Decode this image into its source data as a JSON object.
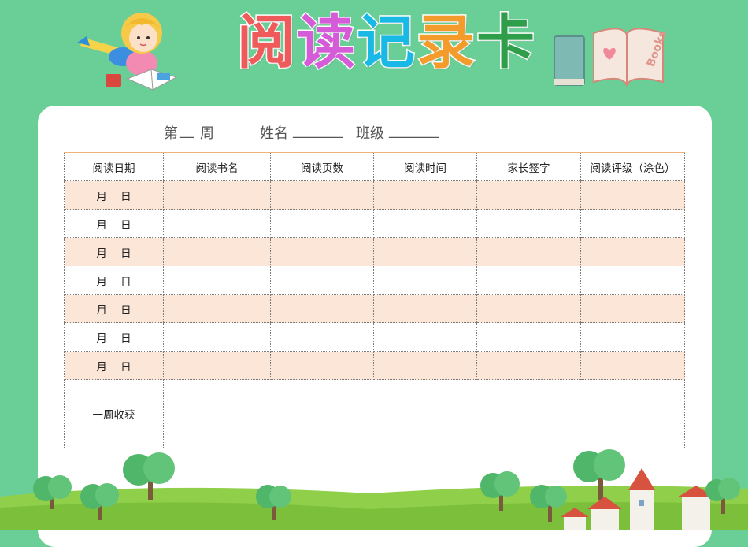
{
  "title": [
    "阅",
    "读",
    "记",
    "录",
    "卡"
  ],
  "title_colors": [
    "#ef5b5b",
    "#d65bd8",
    "#19b9e6",
    "#f39b2b",
    "#2f9e4a"
  ],
  "info": {
    "week_prefix": "第",
    "week_blank": "__",
    "week_suffix": "周",
    "name_label": "姓名",
    "name_blank": "_______",
    "class_label": "班级",
    "class_blank": "_______"
  },
  "table": {
    "headers": [
      "阅读日期",
      "阅读书名",
      "阅读页数",
      "阅读时间",
      "家长签字",
      "阅读评级（涂色）"
    ],
    "date_label": "月    日",
    "rows": 7,
    "weekly_label": "一周收获"
  },
  "decor": {
    "books_text": "Books",
    "colors": {
      "background": "#6acf96",
      "row_shade": "#fbe6d8",
      "table_rule": "#f0b27a"
    }
  }
}
